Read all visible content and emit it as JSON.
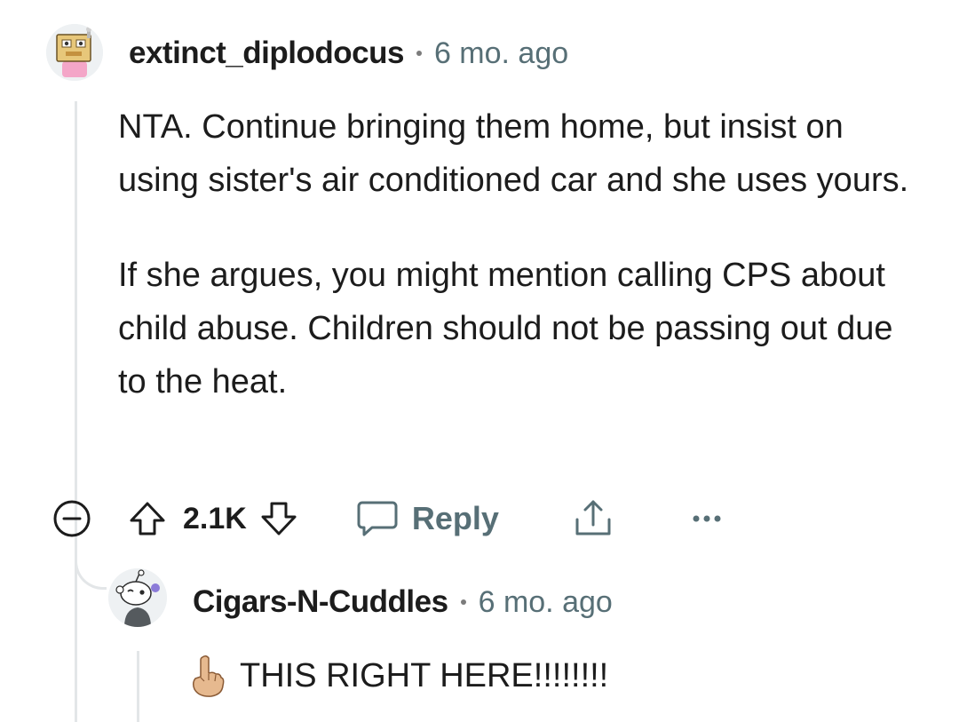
{
  "comment": {
    "username": "extinct_diplodocus",
    "timestamp": "6 mo. ago",
    "avatar_icon": "cardboard-robot-avatar-icon",
    "paragraphs": [
      "NTA. Continue bringing them home, but insist on using sister's air conditioned car and she uses yours.",
      "If she argues, you might mention calling CPS about child abuse. Children should not be passing out due to the heat."
    ],
    "votes": "2.1K",
    "reply_label": "Reply",
    "icons": {
      "collapse": "collapse-minus-icon",
      "upvote": "upvote-arrow-icon",
      "downvote": "downvote-arrow-icon",
      "reply": "speech-bubble-icon",
      "share": "share-icon",
      "more": "more-options-icon"
    }
  },
  "reply": {
    "username": "Cigars-N-Cuddles",
    "timestamp": "6 mo. ago",
    "avatar_icon": "snoo-avatar-icon",
    "emoji": "pointing-up-hand-emoji",
    "text": "THIS RIGHT HERE!!!!!!!!"
  },
  "colors": {
    "text": "#1c1c1c",
    "meta": "#576f76",
    "thread_line": "#e3e6e8"
  }
}
